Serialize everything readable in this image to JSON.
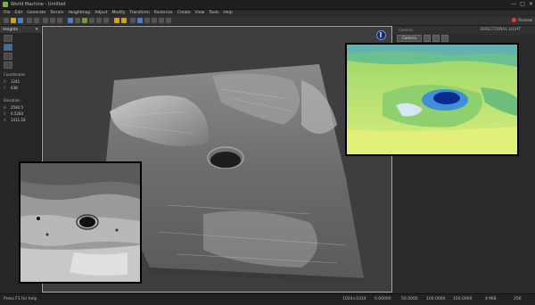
{
  "window": {
    "title": "World Machine - Untitled",
    "buttons": {
      "minimize": "—",
      "maximize": "□",
      "close": "✕"
    }
  },
  "menu": [
    "File",
    "Edit",
    "Generate",
    "Terrain",
    "Heightmap",
    "Adjust",
    "Modify",
    "Transform",
    "Rasterize",
    "Create",
    "View",
    "Tools",
    "Help"
  ],
  "toolbar": {
    "right_toggle_label": "Preview",
    "accent_color": "#c9a227"
  },
  "left_panel": {
    "title": "Heights",
    "close_glyph": "✕",
    "coordinates_label": "Coordinates",
    "coords_rows": [
      {
        "key": "X",
        "value": "1241"
      },
      {
        "key": "Y",
        "value": "438"
      }
    ],
    "elevation_label": "Elevation",
    "elevation_rows": [
      {
        "key": "H",
        "value": "2584.5"
      },
      {
        "key": "S",
        "value": "0.5260"
      },
      {
        "key": "A",
        "value": "1411.18"
      }
    ]
  },
  "right_panel": {
    "label": "Camera",
    "header": "DIRECTIONAL LIGHT",
    "camera_button": "Camera"
  },
  "status": {
    "hint": "Press F1 for help",
    "resolution": "1024×1024",
    "v1": "0.00000",
    "v2": "50.0000",
    "v3": "100.0000",
    "v4": "100.0000",
    "mem": "4 MiB",
    "zoom": "256"
  }
}
